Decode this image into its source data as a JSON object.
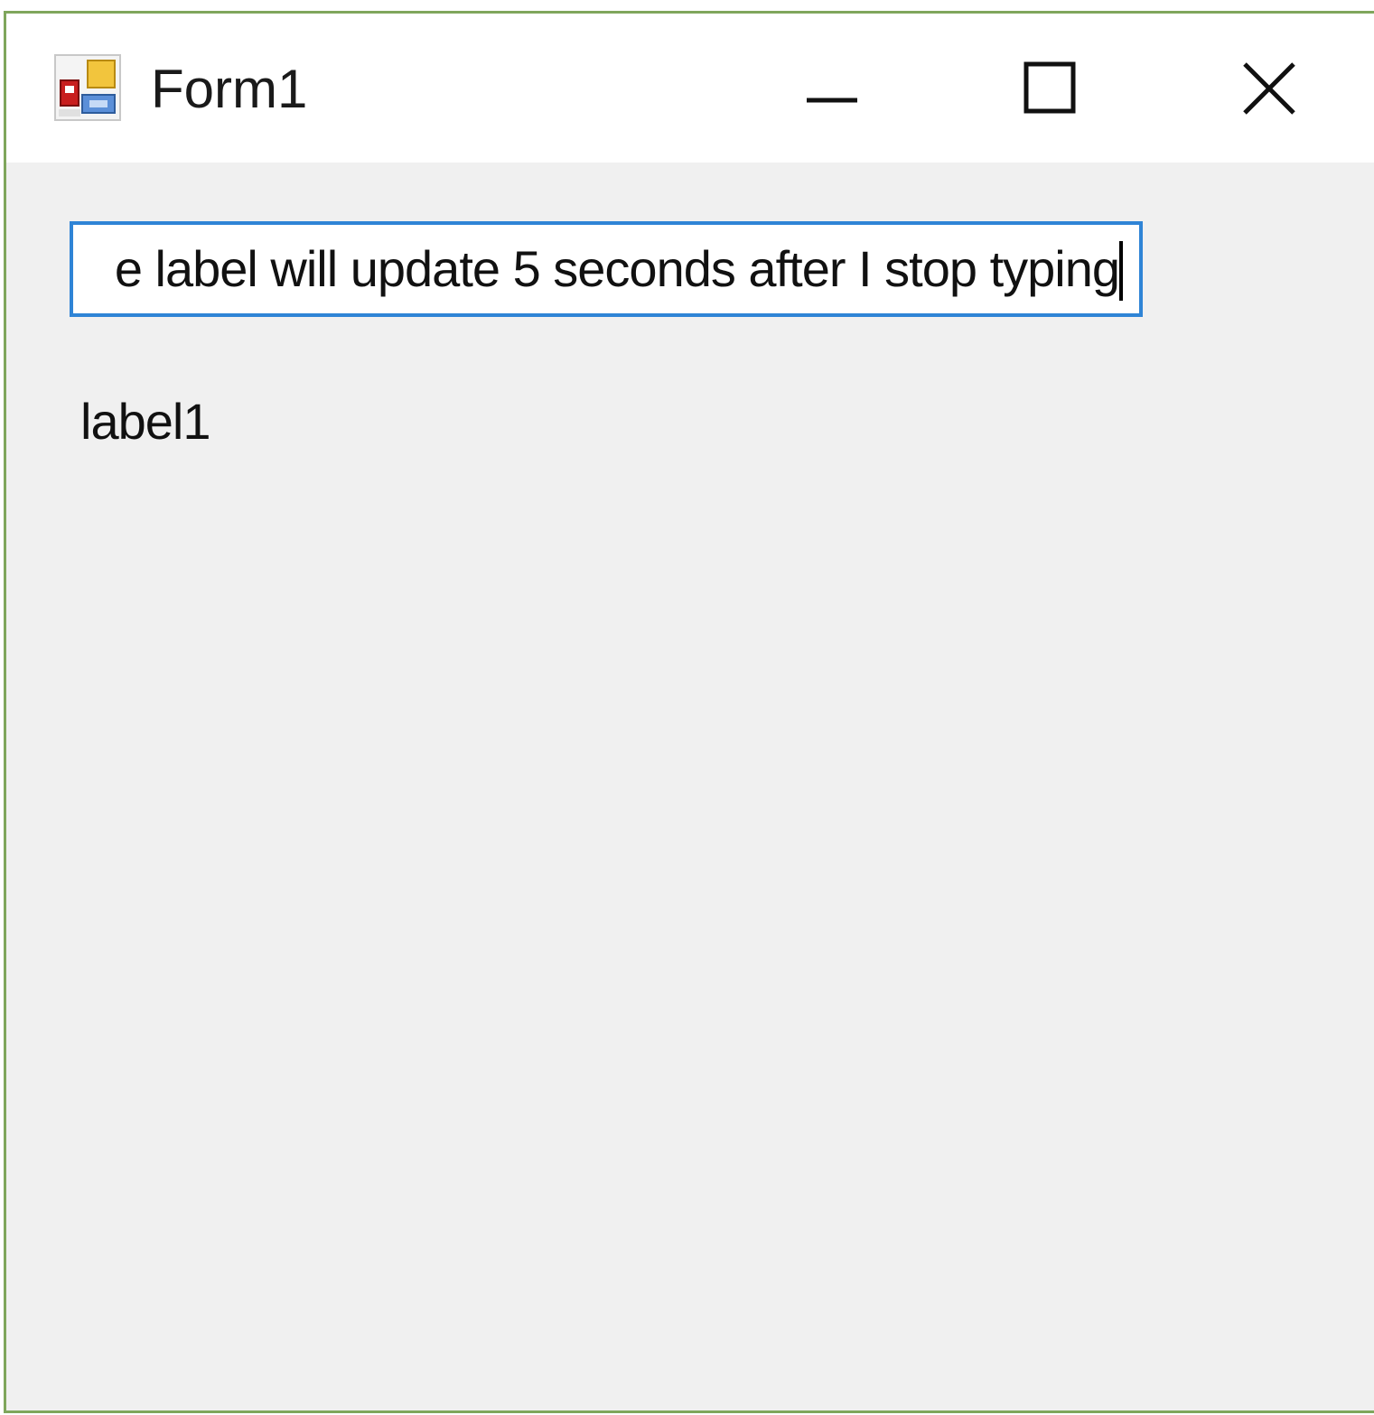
{
  "window": {
    "title": "Form1",
    "app_icon": "winforms-app-icon",
    "controls": {
      "minimize_icon": "minimize-icon",
      "maximize_icon": "maximize-icon",
      "close_icon": "close-icon"
    },
    "frame_color": "#7fa65c"
  },
  "form": {
    "textbox": {
      "value": "e label will update 5 seconds after I stop typing",
      "visible_value": "label will update 5 seconds after I stop typing",
      "focused": true,
      "border_color": "#2f84d6"
    },
    "label": {
      "text": "label1"
    },
    "background_color": "#f0f0f0"
  }
}
